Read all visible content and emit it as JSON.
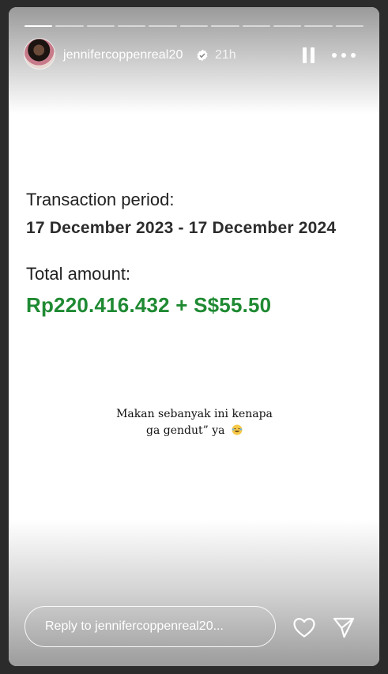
{
  "story": {
    "progress_segments": 11,
    "active_segment": 1,
    "username": "jennifercoppenreal20",
    "verified": true,
    "time_ago": "21h",
    "icons": {
      "avatar": "avatar",
      "verified": "verified-badge-icon",
      "pause": "pause-icon",
      "more": "more-options-icon",
      "heart": "heart-icon",
      "send": "send-icon"
    }
  },
  "content": {
    "period_label": "Transaction period:",
    "period_value": "17 December 2023 - 17 December 2024",
    "total_label": "Total amount:",
    "total_value": "Rp220.416.432 + S$55.50",
    "caption_line1": "Makan sebanyak ini kenapa",
    "caption_line2": "ga gendut” ya"
  },
  "reply": {
    "placeholder": "Reply to jennifercoppenreal20..."
  },
  "colors": {
    "amount": "#1f8a33",
    "background": "#2b2b2b"
  }
}
